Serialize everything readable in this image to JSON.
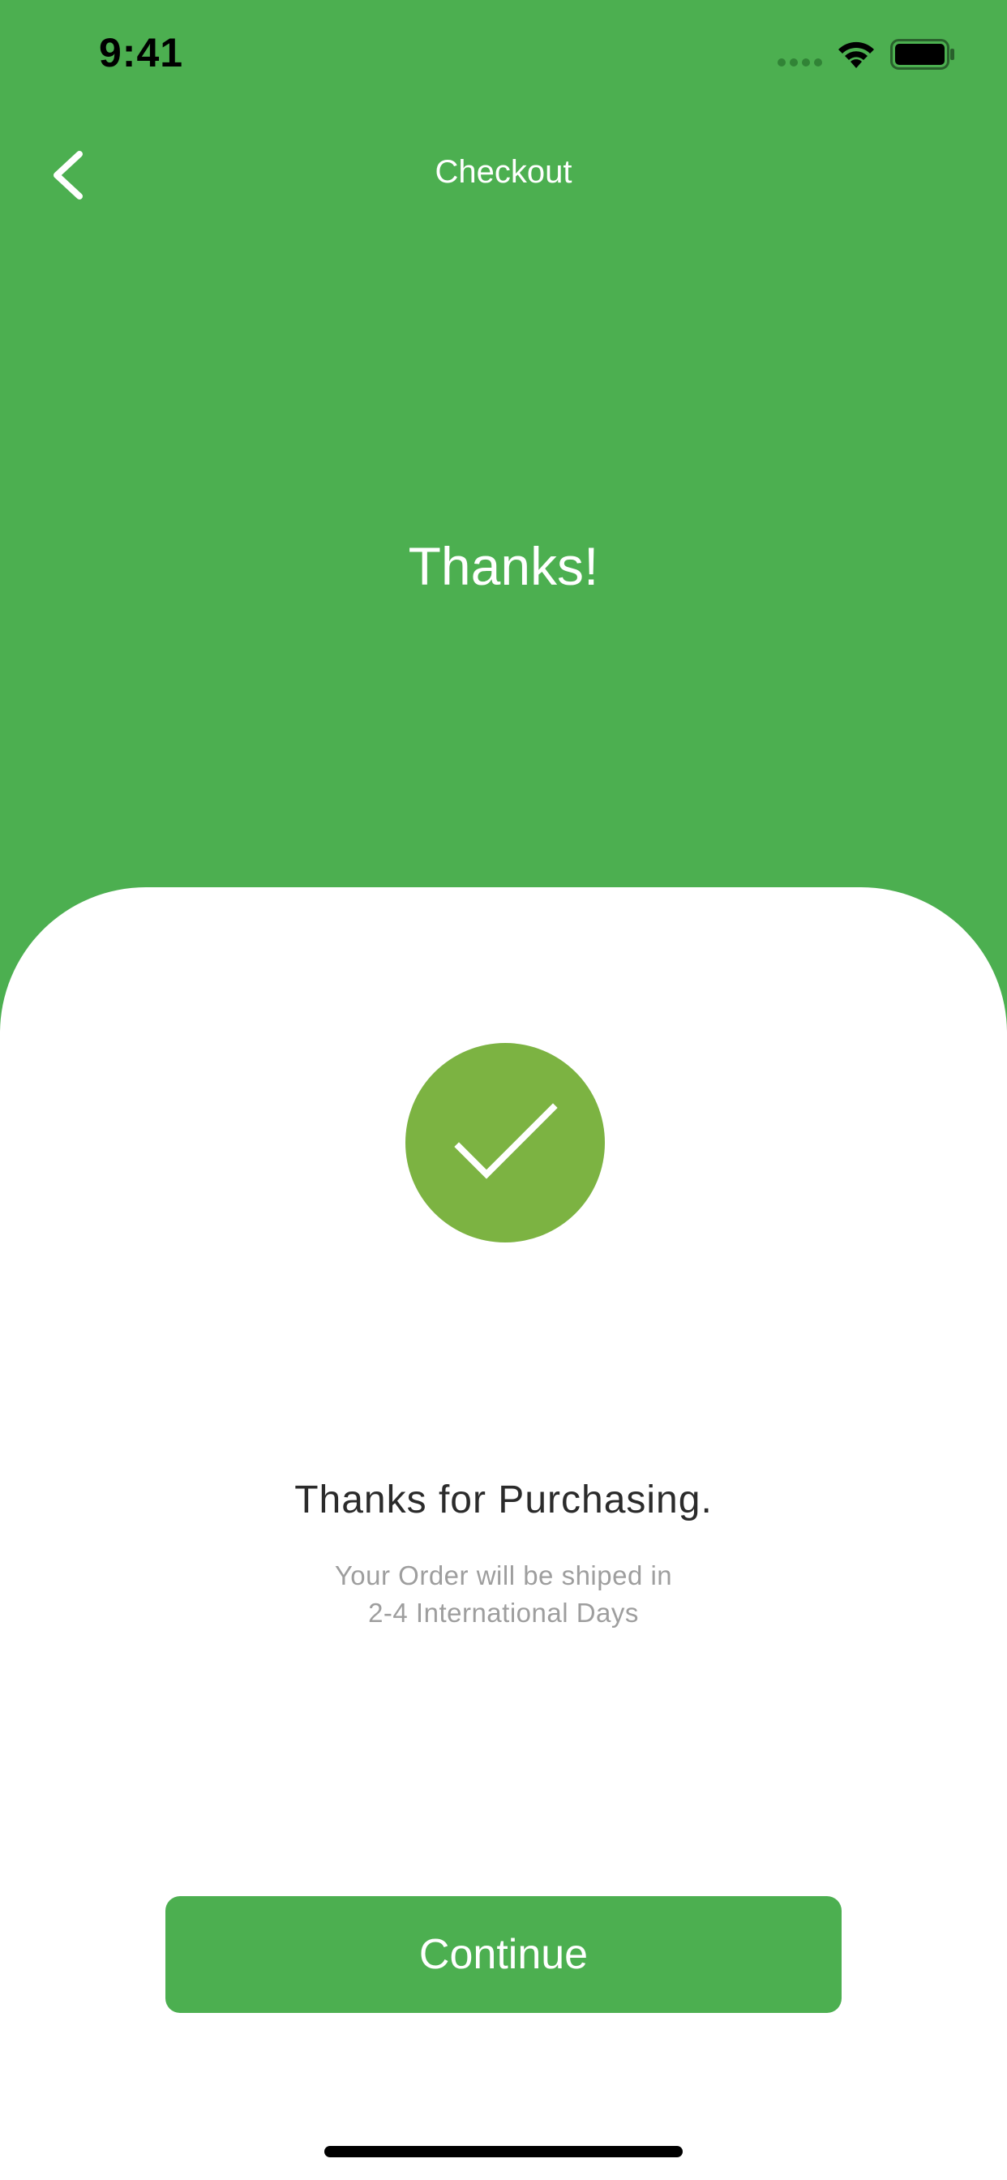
{
  "status_bar": {
    "time": "9:41",
    "signal_icon": "cellular-signal-icon",
    "wifi_icon": "wifi-icon",
    "battery_icon": "battery-icon"
  },
  "nav": {
    "back_icon": "chevron-left-icon",
    "title": "Checkout"
  },
  "hero": {
    "title": "Thanks!"
  },
  "confirmation": {
    "icon": "checkmark-icon",
    "heading": "Thanks for Purchasing.",
    "note_line1": "Your Order will be shiped in",
    "note_line2": "2-4 International Days"
  },
  "actions": {
    "continue_label": "Continue"
  },
  "colors": {
    "primary_green": "#4caf50",
    "check_green": "#7cb342",
    "card_background": "#ffffff",
    "heading_text": "#2b2b2b",
    "muted_text": "#9e9e9e"
  }
}
